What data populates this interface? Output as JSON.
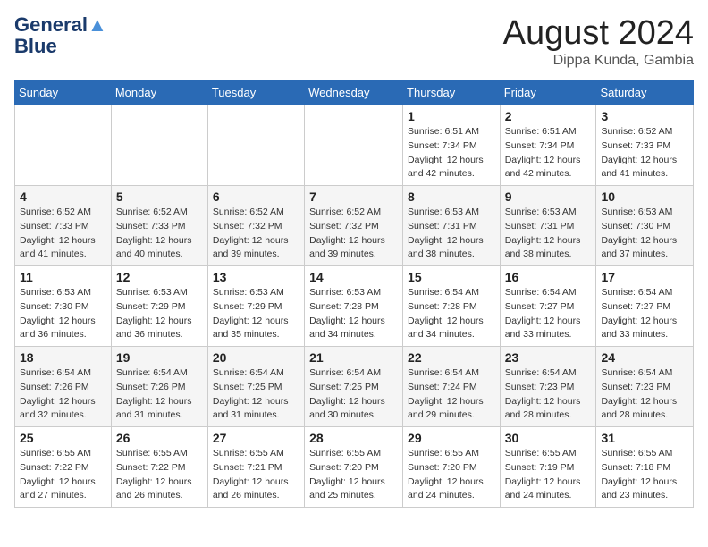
{
  "header": {
    "logo_line1": "General",
    "logo_line2": "Blue",
    "month_year": "August 2024",
    "location": "Dippa Kunda, Gambia"
  },
  "weekdays": [
    "Sunday",
    "Monday",
    "Tuesday",
    "Wednesday",
    "Thursday",
    "Friday",
    "Saturday"
  ],
  "weeks": [
    [
      {
        "day": "",
        "sunrise": "",
        "sunset": "",
        "daylight": ""
      },
      {
        "day": "",
        "sunrise": "",
        "sunset": "",
        "daylight": ""
      },
      {
        "day": "",
        "sunrise": "",
        "sunset": "",
        "daylight": ""
      },
      {
        "day": "",
        "sunrise": "",
        "sunset": "",
        "daylight": ""
      },
      {
        "day": "1",
        "sunrise": "Sunrise: 6:51 AM",
        "sunset": "Sunset: 7:34 PM",
        "daylight": "Daylight: 12 hours and 42 minutes."
      },
      {
        "day": "2",
        "sunrise": "Sunrise: 6:51 AM",
        "sunset": "Sunset: 7:34 PM",
        "daylight": "Daylight: 12 hours and 42 minutes."
      },
      {
        "day": "3",
        "sunrise": "Sunrise: 6:52 AM",
        "sunset": "Sunset: 7:33 PM",
        "daylight": "Daylight: 12 hours and 41 minutes."
      }
    ],
    [
      {
        "day": "4",
        "sunrise": "Sunrise: 6:52 AM",
        "sunset": "Sunset: 7:33 PM",
        "daylight": "Daylight: 12 hours and 41 minutes."
      },
      {
        "day": "5",
        "sunrise": "Sunrise: 6:52 AM",
        "sunset": "Sunset: 7:33 PM",
        "daylight": "Daylight: 12 hours and 40 minutes."
      },
      {
        "day": "6",
        "sunrise": "Sunrise: 6:52 AM",
        "sunset": "Sunset: 7:32 PM",
        "daylight": "Daylight: 12 hours and 39 minutes."
      },
      {
        "day": "7",
        "sunrise": "Sunrise: 6:52 AM",
        "sunset": "Sunset: 7:32 PM",
        "daylight": "Daylight: 12 hours and 39 minutes."
      },
      {
        "day": "8",
        "sunrise": "Sunrise: 6:53 AM",
        "sunset": "Sunset: 7:31 PM",
        "daylight": "Daylight: 12 hours and 38 minutes."
      },
      {
        "day": "9",
        "sunrise": "Sunrise: 6:53 AM",
        "sunset": "Sunset: 7:31 PM",
        "daylight": "Daylight: 12 hours and 38 minutes."
      },
      {
        "day": "10",
        "sunrise": "Sunrise: 6:53 AM",
        "sunset": "Sunset: 7:30 PM",
        "daylight": "Daylight: 12 hours and 37 minutes."
      }
    ],
    [
      {
        "day": "11",
        "sunrise": "Sunrise: 6:53 AM",
        "sunset": "Sunset: 7:30 PM",
        "daylight": "Daylight: 12 hours and 36 minutes."
      },
      {
        "day": "12",
        "sunrise": "Sunrise: 6:53 AM",
        "sunset": "Sunset: 7:29 PM",
        "daylight": "Daylight: 12 hours and 36 minutes."
      },
      {
        "day": "13",
        "sunrise": "Sunrise: 6:53 AM",
        "sunset": "Sunset: 7:29 PM",
        "daylight": "Daylight: 12 hours and 35 minutes."
      },
      {
        "day": "14",
        "sunrise": "Sunrise: 6:53 AM",
        "sunset": "Sunset: 7:28 PM",
        "daylight": "Daylight: 12 hours and 34 minutes."
      },
      {
        "day": "15",
        "sunrise": "Sunrise: 6:54 AM",
        "sunset": "Sunset: 7:28 PM",
        "daylight": "Daylight: 12 hours and 34 minutes."
      },
      {
        "day": "16",
        "sunrise": "Sunrise: 6:54 AM",
        "sunset": "Sunset: 7:27 PM",
        "daylight": "Daylight: 12 hours and 33 minutes."
      },
      {
        "day": "17",
        "sunrise": "Sunrise: 6:54 AM",
        "sunset": "Sunset: 7:27 PM",
        "daylight": "Daylight: 12 hours and 33 minutes."
      }
    ],
    [
      {
        "day": "18",
        "sunrise": "Sunrise: 6:54 AM",
        "sunset": "Sunset: 7:26 PM",
        "daylight": "Daylight: 12 hours and 32 minutes."
      },
      {
        "day": "19",
        "sunrise": "Sunrise: 6:54 AM",
        "sunset": "Sunset: 7:26 PM",
        "daylight": "Daylight: 12 hours and 31 minutes."
      },
      {
        "day": "20",
        "sunrise": "Sunrise: 6:54 AM",
        "sunset": "Sunset: 7:25 PM",
        "daylight": "Daylight: 12 hours and 31 minutes."
      },
      {
        "day": "21",
        "sunrise": "Sunrise: 6:54 AM",
        "sunset": "Sunset: 7:25 PM",
        "daylight": "Daylight: 12 hours and 30 minutes."
      },
      {
        "day": "22",
        "sunrise": "Sunrise: 6:54 AM",
        "sunset": "Sunset: 7:24 PM",
        "daylight": "Daylight: 12 hours and 29 minutes."
      },
      {
        "day": "23",
        "sunrise": "Sunrise: 6:54 AM",
        "sunset": "Sunset: 7:23 PM",
        "daylight": "Daylight: 12 hours and 28 minutes."
      },
      {
        "day": "24",
        "sunrise": "Sunrise: 6:54 AM",
        "sunset": "Sunset: 7:23 PM",
        "daylight": "Daylight: 12 hours and 28 minutes."
      }
    ],
    [
      {
        "day": "25",
        "sunrise": "Sunrise: 6:55 AM",
        "sunset": "Sunset: 7:22 PM",
        "daylight": "Daylight: 12 hours and 27 minutes."
      },
      {
        "day": "26",
        "sunrise": "Sunrise: 6:55 AM",
        "sunset": "Sunset: 7:22 PM",
        "daylight": "Daylight: 12 hours and 26 minutes."
      },
      {
        "day": "27",
        "sunrise": "Sunrise: 6:55 AM",
        "sunset": "Sunset: 7:21 PM",
        "daylight": "Daylight: 12 hours and 26 minutes."
      },
      {
        "day": "28",
        "sunrise": "Sunrise: 6:55 AM",
        "sunset": "Sunset: 7:20 PM",
        "daylight": "Daylight: 12 hours and 25 minutes."
      },
      {
        "day": "29",
        "sunrise": "Sunrise: 6:55 AM",
        "sunset": "Sunset: 7:20 PM",
        "daylight": "Daylight: 12 hours and 24 minutes."
      },
      {
        "day": "30",
        "sunrise": "Sunrise: 6:55 AM",
        "sunset": "Sunset: 7:19 PM",
        "daylight": "Daylight: 12 hours and 24 minutes."
      },
      {
        "day": "31",
        "sunrise": "Sunrise: 6:55 AM",
        "sunset": "Sunset: 7:18 PM",
        "daylight": "Daylight: 12 hours and 23 minutes."
      }
    ]
  ]
}
